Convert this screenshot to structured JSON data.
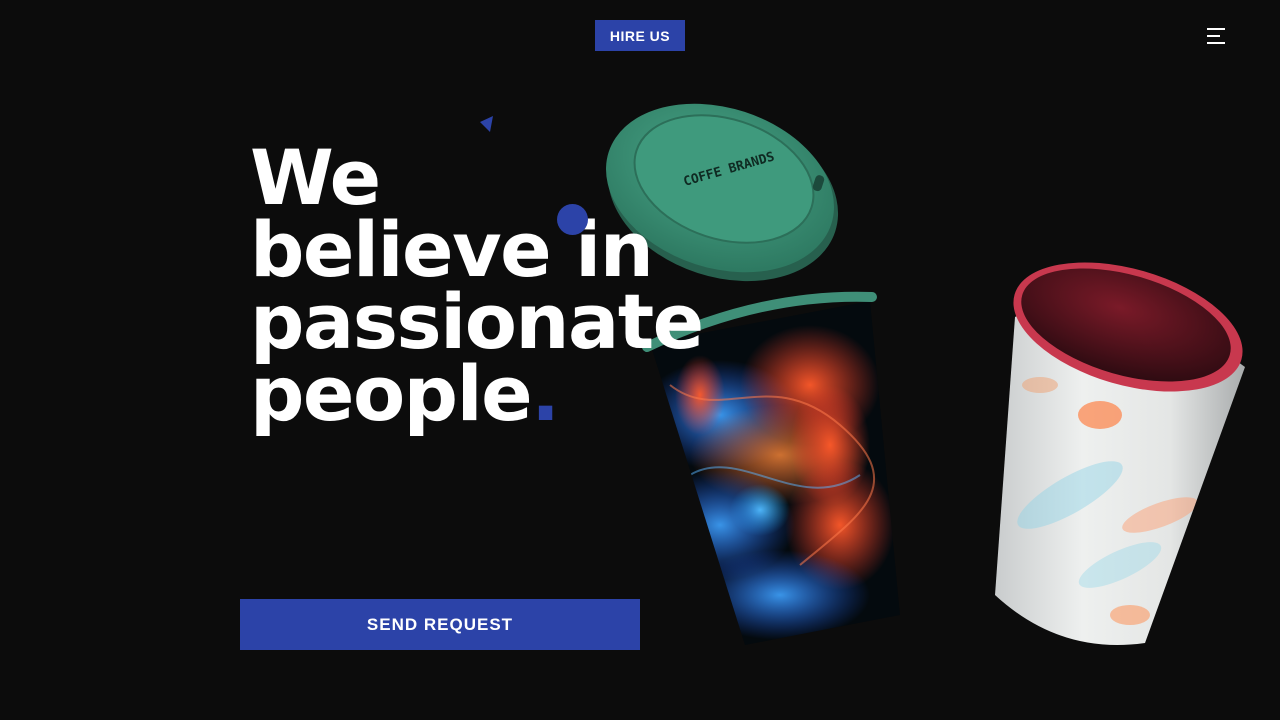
{
  "header": {
    "hire_label": "HIRE US",
    "menu_icon": "hamburger-menu-icon"
  },
  "hero": {
    "headline_lines": [
      "We",
      "believe in",
      "passionate",
      "people"
    ],
    "headline_period": ".",
    "send_label": "SEND REQUEST"
  },
  "artwork": {
    "lid_brand": "COFFE BRANDS"
  },
  "colors": {
    "background": "#0c0c0c",
    "accent": "#2c43a8",
    "lid_green": "#3c8c74",
    "cup_rim_red": "#c8384e"
  }
}
